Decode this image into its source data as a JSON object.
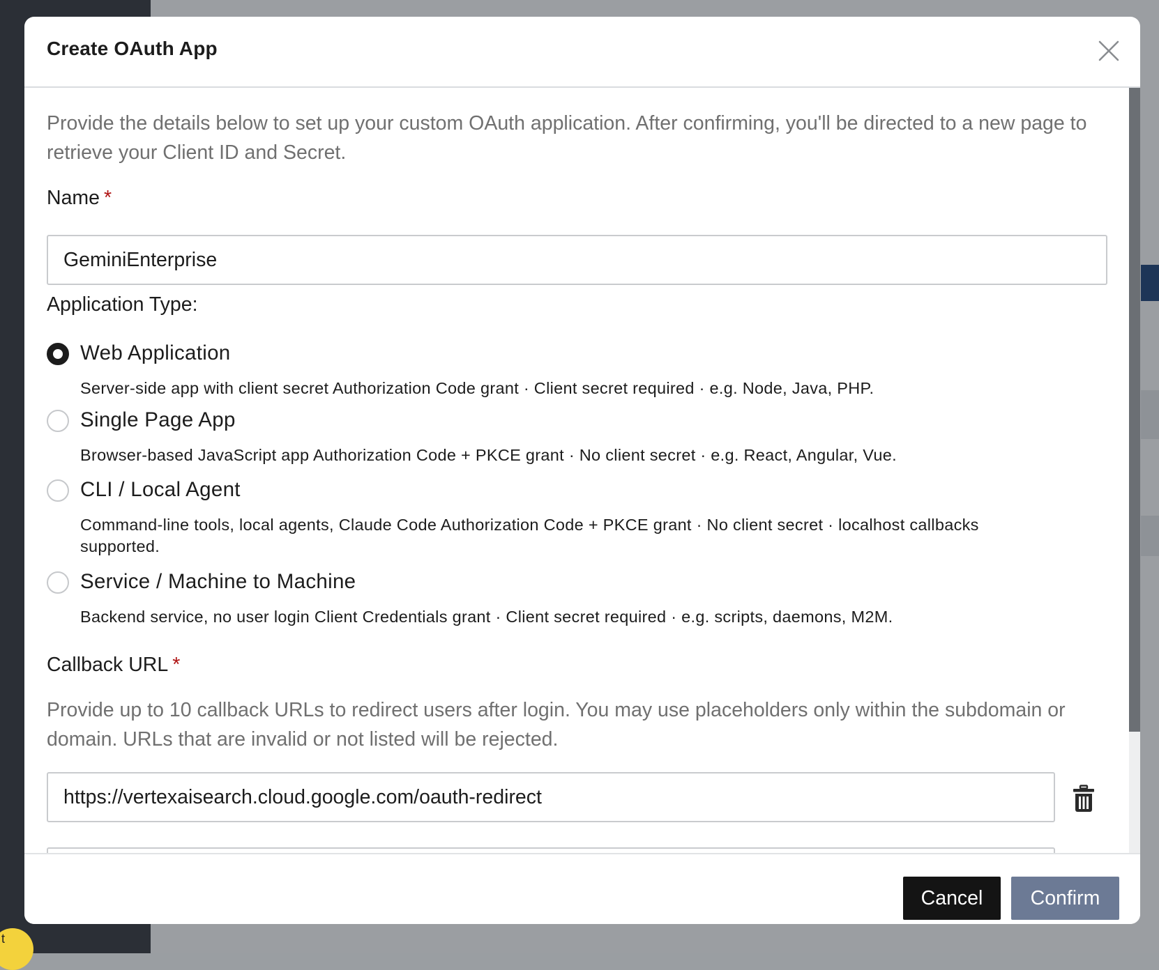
{
  "modal": {
    "title": "Create OAuth App",
    "intro": "Provide the details below to set up your custom OAuth application. After confirming, you'll be directed to a new page to retrieve your Client ID and Secret."
  },
  "name_field": {
    "label": "Name",
    "required_mark": "*",
    "value": "GeminiEnterprise"
  },
  "application_type": {
    "label": "Application Type:",
    "selected": "Web Application",
    "options": [
      {
        "label": "Web Application",
        "description": "Server-side app with client secret Authorization Code grant · Client secret required · e.g. Node, Java, PHP."
      },
      {
        "label": "Single Page App",
        "description": "Browser-based JavaScript app Authorization Code + PKCE grant · No client secret · e.g. React, Angular, Vue."
      },
      {
        "label": "CLI / Local Agent",
        "description": "Command-line tools, local agents, Claude Code Authorization Code + PKCE grant · No client secret · localhost callbacks supported."
      },
      {
        "label": "Service / Machine to Machine",
        "description": "Backend service, no user login Client Credentials grant · Client secret required · e.g. scripts, daemons, M2M."
      }
    ]
  },
  "callback": {
    "label": "Callback URL",
    "required_mark": "*",
    "help": "Provide up to 10 callback URLs to redirect users after login. You may use placeholders only within the subdomain or domain. URLs that are invalid or not listed will be rejected.",
    "urls": [
      "https://vertexaisearch.cloud.google.com/oauth-redirect"
    ]
  },
  "footer": {
    "cancel_label": "Cancel",
    "confirm_label": "Confirm"
  },
  "background": {
    "help_bubble_text": "t"
  },
  "icons": {
    "close": "close-icon",
    "delete": "trash-icon"
  },
  "colors": {
    "overlay": "#9b9ea2",
    "sidebar": "#2b2f36",
    "required": "#b01515",
    "cancel_button": "#141414",
    "confirm_button": "#6c7a95",
    "muted_text": "#707070"
  }
}
